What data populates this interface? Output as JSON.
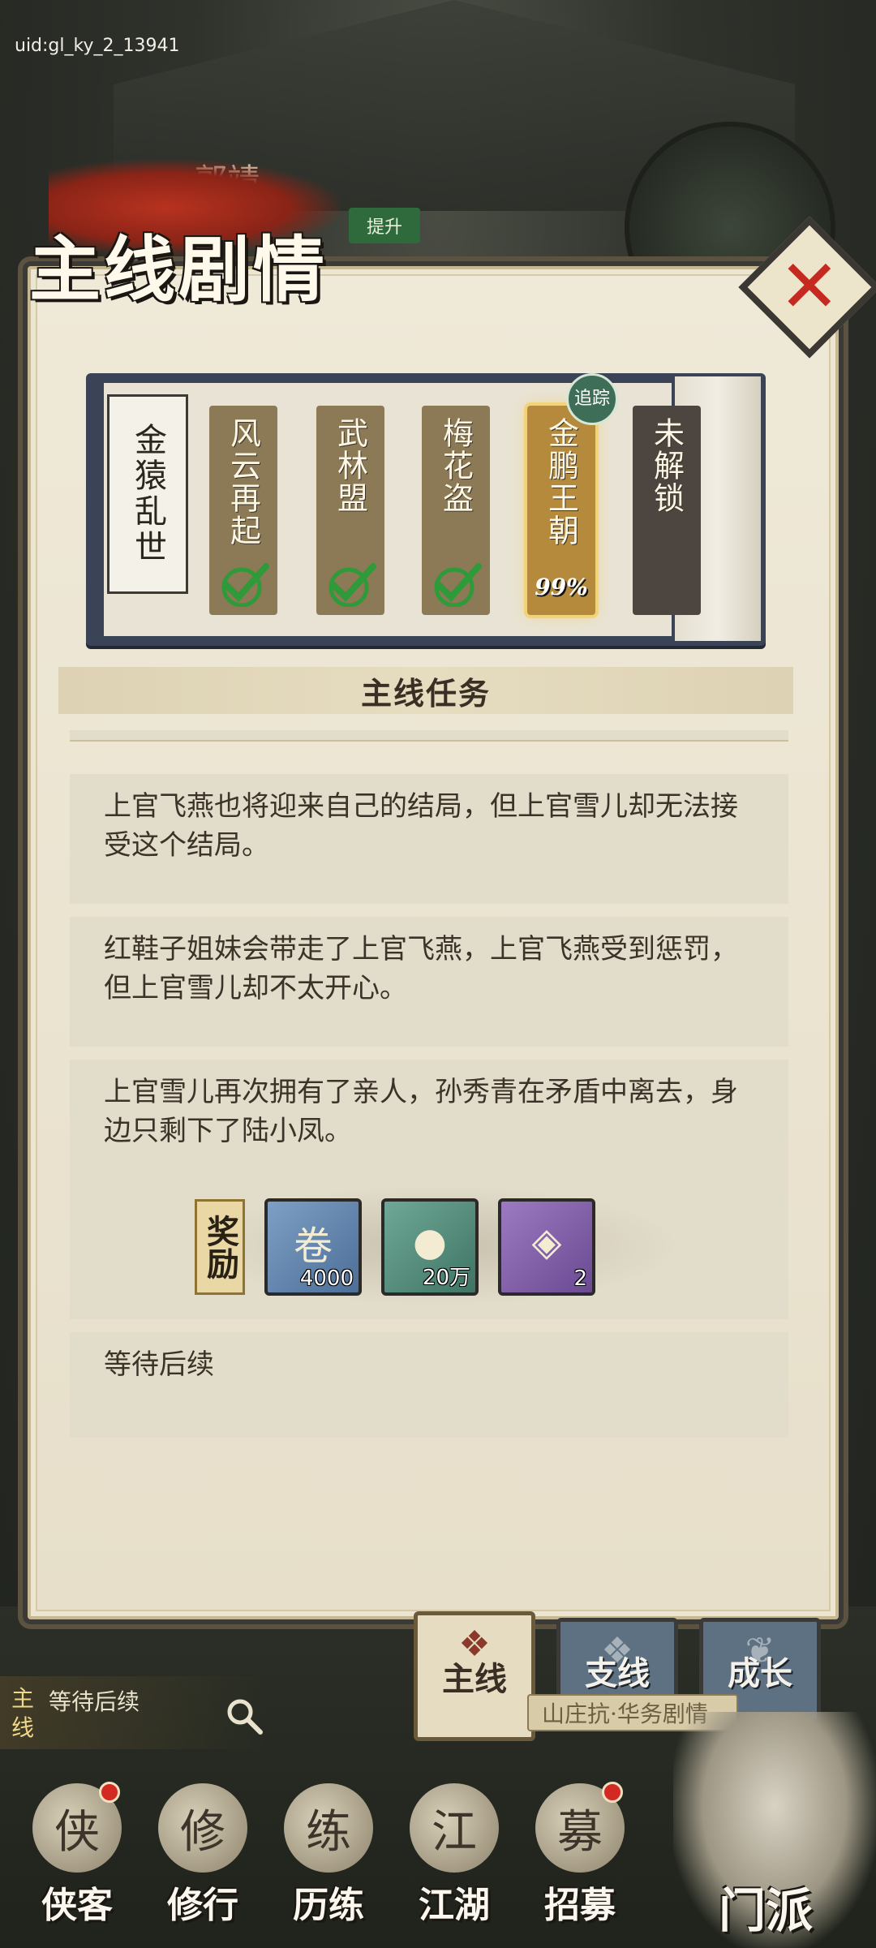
{
  "uid": "uid:gl_ky_2_13941",
  "background": {
    "character_name": "郭靖",
    "upgrade_label": "提升"
  },
  "panel": {
    "title": "主线剧情",
    "close_symbol": "✕"
  },
  "story": {
    "volume": "金猿乱世",
    "chapters": [
      {
        "label": "风云再起",
        "state": "completed"
      },
      {
        "label": "武林盟",
        "state": "completed"
      },
      {
        "label": "梅花盗",
        "state": "completed"
      },
      {
        "label": "金鹏王朝",
        "state": "current",
        "progress": "99%"
      },
      {
        "label": "未解锁",
        "state": "locked"
      }
    ],
    "track_badge": "追踪"
  },
  "section": {
    "title": "主线任务"
  },
  "tasks": [
    {
      "text": "上官飞燕也将迎来自己的结局，但上官雪儿却无法接受这个结局。"
    },
    {
      "text": "红鞋子姐妹会带走了上官飞燕，上官飞燕受到惩罚，但上官雪儿却不太开心。"
    },
    {
      "text": "上官雪儿再次拥有了亲人，孙秀青在矛盾中离去，身边只剩下了陆小凤。"
    },
    {
      "text": "等待后续"
    }
  ],
  "rewards": {
    "label": "奖励",
    "items": [
      {
        "icon": "scroll-icon",
        "glyph": "卷",
        "count": "4000",
        "color": "blue"
      },
      {
        "icon": "orb-icon",
        "glyph": "●",
        "count": "20万",
        "color": "teal"
      },
      {
        "icon": "medal-icon",
        "glyph": "◈",
        "count": "2",
        "color": "purple"
      }
    ]
  },
  "tabs": {
    "main": "主线",
    "branch": "支线",
    "growth": "成长"
  },
  "tracker": {
    "type": "主线",
    "text": "等待后续",
    "hint": "山庄抗·华务剧情"
  },
  "nav": {
    "items": [
      {
        "label": "侠客",
        "glyph": "侠"
      },
      {
        "label": "修行",
        "glyph": "修"
      },
      {
        "label": "历练",
        "glyph": "练"
      },
      {
        "label": "江湖",
        "glyph": "江"
      },
      {
        "label": "招募",
        "glyph": "募"
      }
    ],
    "sect": "门派"
  },
  "colors": {
    "accent_red": "#c42a1f",
    "completed_green": "#2f9a3a",
    "panel_bg": "#ece5d2"
  }
}
